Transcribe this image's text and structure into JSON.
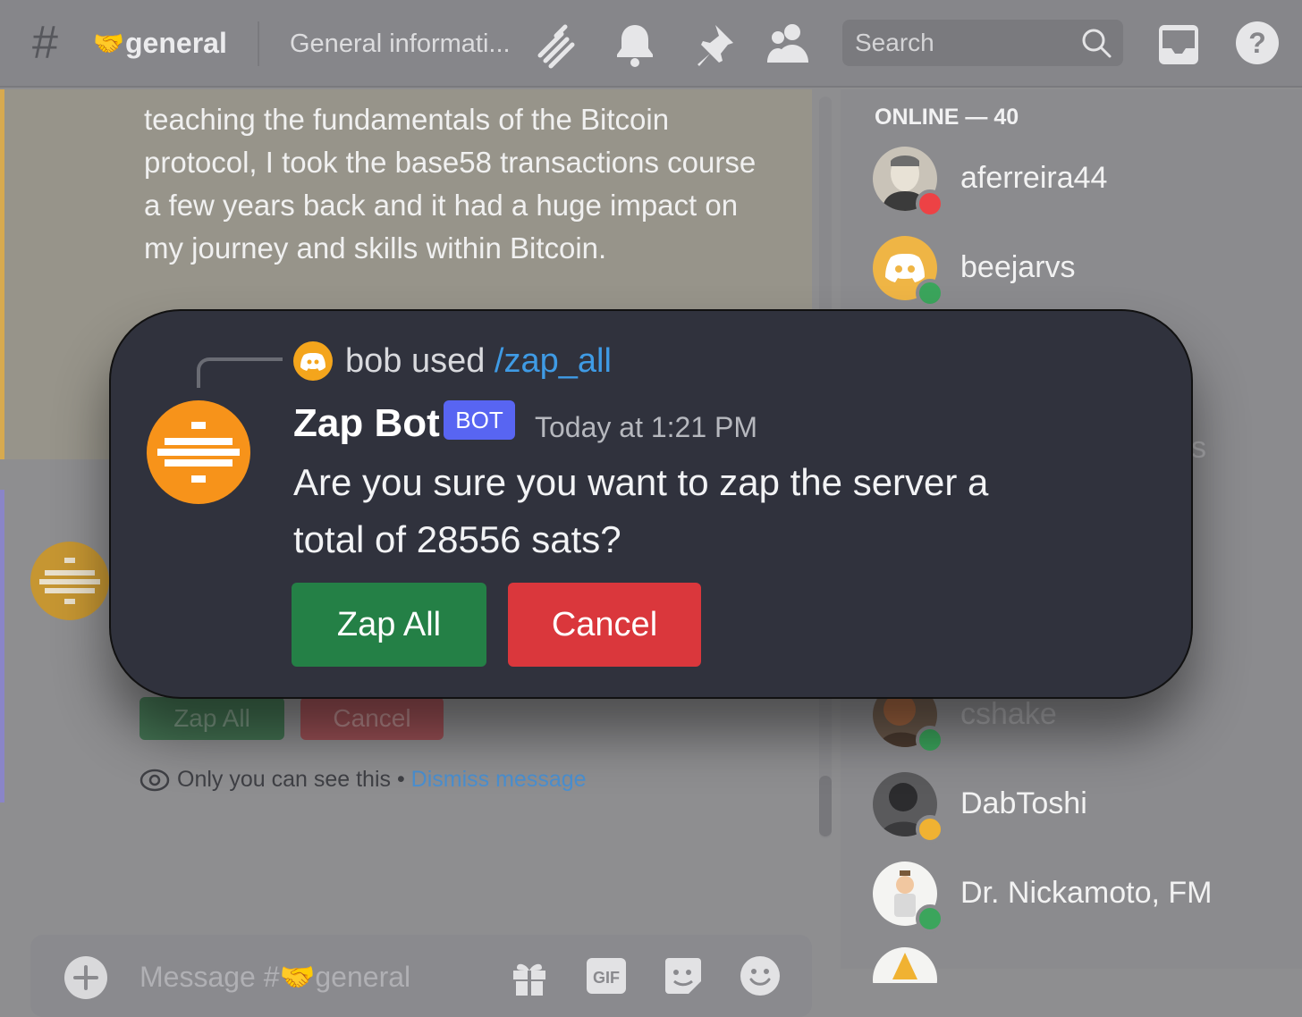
{
  "header": {
    "channel_emoji": "🤝",
    "channel_name": "general",
    "topic": "General informati...",
    "search_placeholder": "Search"
  },
  "previous_message": {
    "text": "teaching the fundamentals of the Bitcoin protocol, I took the base58 transactions course a few years back and it had a huge impact on my journey and skills within Bitcoin."
  },
  "background_message": {
    "zap_label": "Zap All",
    "cancel_label": "Cancel",
    "ephemeral_note": "Only you can see this",
    "separator": " • ",
    "dismiss_label": "Dismiss message"
  },
  "composer": {
    "placeholder": "Message #🤝general"
  },
  "members": {
    "header": "ONLINE — 40",
    "items": [
      {
        "name": "aferreira44",
        "status": "dnd",
        "status_color": "#ed4245"
      },
      {
        "name": "beejarvs",
        "status": "online",
        "status_color": "#3ba55c"
      },
      {
        "name": "cshake",
        "status": "online",
        "status_color": "#3ba55c"
      },
      {
        "name": "DabToshi",
        "status": "idle",
        "status_color": "#f0b232"
      },
      {
        "name": "Dr. Nickamoto, FM",
        "status": "online",
        "status_color": "#3ba55c"
      }
    ],
    "partial_name_fragment": "s"
  },
  "dialog": {
    "reply_user": "bob used ",
    "reply_command": "/zap_all",
    "bot_name": "Zap Bot",
    "bot_tag": "BOT",
    "timestamp": "Today at 1:21 PM",
    "message": "Are you sure you want to zap the server a total of 28556 sats?",
    "zap_button": "Zap All",
    "cancel_button": "Cancel"
  },
  "colors": {
    "zap_green": "#248046",
    "cancel_red": "#da373c",
    "bot_tag_blurple": "#5865f2",
    "zap_bot_orange": "#f7931a",
    "command_blue": "#3f9be5"
  }
}
